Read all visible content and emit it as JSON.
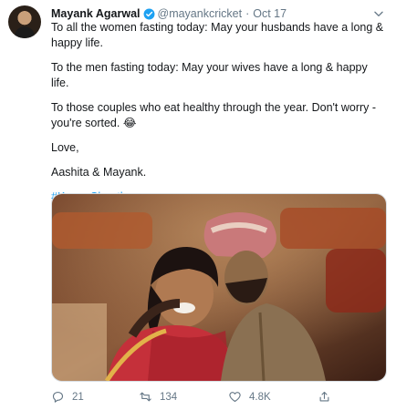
{
  "tweet": {
    "author_name": "Mayank Agarwal",
    "handle": "@mayankcricket",
    "separator": "·",
    "date": "Oct 17",
    "paragraphs": [
      "To all the women fasting today: May your husbands have a long & happy life.",
      "To the men fasting today: May your wives have a long & happy life.",
      "To those couples who eat healthy through the year. Don't worry - you're sorted. 😂",
      "Love,",
      "Aashita & Mayank."
    ],
    "hashtag": "#KarwaChauth"
  },
  "actions": {
    "replies": "21",
    "retweets": "134",
    "likes": "4.8K"
  },
  "colors": {
    "accent": "#1da1f2",
    "muted": "#657786",
    "text": "#14171a"
  },
  "icons": {
    "verified": "verified-badge-icon",
    "menu": "chevron-down-icon",
    "reply": "reply-icon",
    "retweet": "retweet-icon",
    "like": "heart-icon",
    "share": "share-icon"
  }
}
